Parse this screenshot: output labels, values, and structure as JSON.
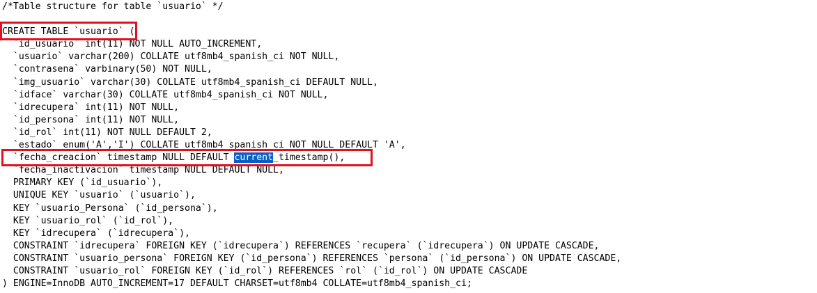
{
  "code": {
    "lines": [
      "/*Table structure for table `usuario` */",
      "",
      "CREATE TABLE `usuario` (",
      "  `id_usuario` int(11) NOT NULL AUTO_INCREMENT,",
      "  `usuario` varchar(200) COLLATE utf8mb4_spanish_ci NOT NULL,",
      "  `contrasena` varbinary(50) NOT NULL,",
      "  `img_usuario` varchar(30) COLLATE utf8mb4_spanish_ci DEFAULT NULL,",
      "  `idface` varchar(30) COLLATE utf8mb4_spanish_ci NOT NULL,",
      "  `idrecupera` int(11) NOT NULL,",
      "  `id_persona` int(11) NOT NULL,",
      "  `id_rol` int(11) NOT NULL DEFAULT 2,",
      "  `estado` enum('A','I') COLLATE utf8mb4_spanish_ci NOT NULL DEFAULT 'A',",
      "",
      "  `fecha_inactivacion` timestamp NULL DEFAULT NULL,",
      "  PRIMARY KEY (`id_usuario`),",
      "  UNIQUE KEY `usuario` (`usuario`),",
      "  KEY `usuario_Persona` (`id_persona`),",
      "  KEY `usuario_rol` (`id_rol`),",
      "  KEY `idrecupera` (`idrecupera`),",
      "  CONSTRAINT `idrecupera` FOREIGN KEY (`idrecupera`) REFERENCES `recupera` (`idrecupera`) ON UPDATE CASCADE,",
      "  CONSTRAINT `usuario_persona` FOREIGN KEY (`id_persona`) REFERENCES `persona` (`id_persona`) ON UPDATE CASCADE,",
      "  CONSTRAINT `usuario_rol` FOREIGN KEY (`id_rol`) REFERENCES `rol` (`id_rol`) ON UPDATE CASCADE",
      ") ENGINE=InnoDB AUTO_INCREMENT=17 DEFAULT CHARSET=utf8mb4 COLLATE=utf8mb4_spanish_ci;"
    ],
    "highlight_line": {
      "before": "  `fecha_creacion` timestamp NULL DEFAULT ",
      "selected": "current",
      "after": "_timestamp(),"
    }
  },
  "colors": {
    "selection": "#0a5fc4",
    "annotation_box": "#e0101f"
  }
}
